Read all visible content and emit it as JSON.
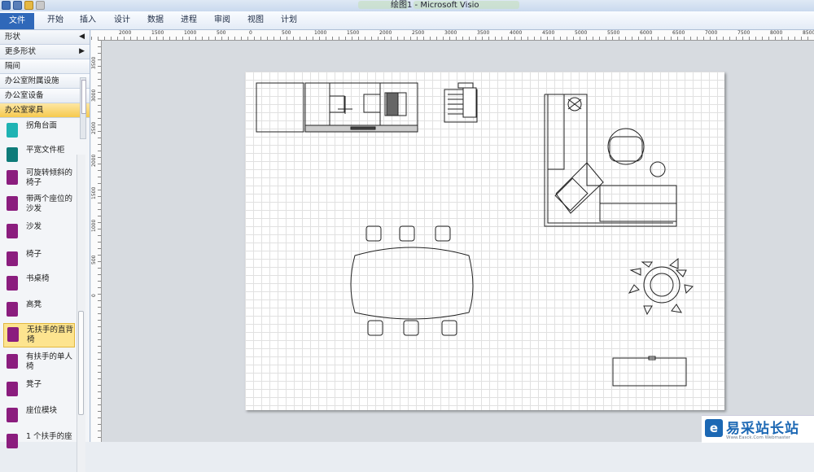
{
  "window": {
    "title": "绘图1  -  Microsoft Visio"
  },
  "ribbon": {
    "file_tab": "文件",
    "tabs": [
      "开始",
      "插入",
      "设计",
      "数据",
      "进程",
      "审阅",
      "视图",
      "计划"
    ]
  },
  "shapes_pane": {
    "title": "形状",
    "more_shapes": "更多形状",
    "stencils": [
      "隔间",
      "办公室附属设施",
      "办公室设备",
      "办公室家具"
    ],
    "active_stencil": "办公室家具",
    "masters": [
      {
        "label": "拐角台面",
        "icon_color": "#1fb3b3"
      },
      {
        "label": "平宽文件柜",
        "icon_color": "#0e7b79"
      },
      {
        "label": "可旋转倾斜的椅子",
        "icon_color": "#8b1d7e"
      },
      {
        "label": "带两个座位的沙发",
        "icon_color": "#8b1d7e"
      },
      {
        "label": "沙发",
        "icon_color": "#8b1d7e"
      },
      {
        "label": "椅子",
        "icon_color": "#8b1d7e"
      },
      {
        "label": "书桌椅",
        "icon_color": "#8b1d7e"
      },
      {
        "label": "高凳",
        "icon_color": "#8b1d7e"
      },
      {
        "label": "无扶手的直背椅",
        "icon_color": "#8b1d7e",
        "selected": true
      },
      {
        "label": "有扶手的单人椅",
        "icon_color": "#8b1d7e"
      },
      {
        "label": "凳子",
        "icon_color": "#8b1d7e"
      },
      {
        "label": "座位模块",
        "icon_color": "#8b1d7e"
      },
      {
        "label": "1 个扶手的座",
        "icon_color": "#8b1d7e"
      }
    ]
  },
  "ruler": {
    "h_ticks": [
      "2000",
      "1500",
      "1000",
      "500",
      "0",
      "500",
      "1000",
      "1500",
      "2000",
      "2500",
      "3000",
      "3500",
      "4000",
      "4500",
      "5000",
      "5500",
      "6000",
      "6500",
      "7000",
      "7500",
      "8000",
      "8500"
    ],
    "v_ticks": [
      "3500",
      "3000",
      "2500",
      "2000",
      "1500",
      "1000",
      "500",
      "0"
    ]
  },
  "watermark": {
    "text": "易采站长站",
    "url": "Www.Easck.Com Webmaster"
  },
  "colors": {
    "accent": "#2f68b9",
    "selected": "#fde48f"
  }
}
